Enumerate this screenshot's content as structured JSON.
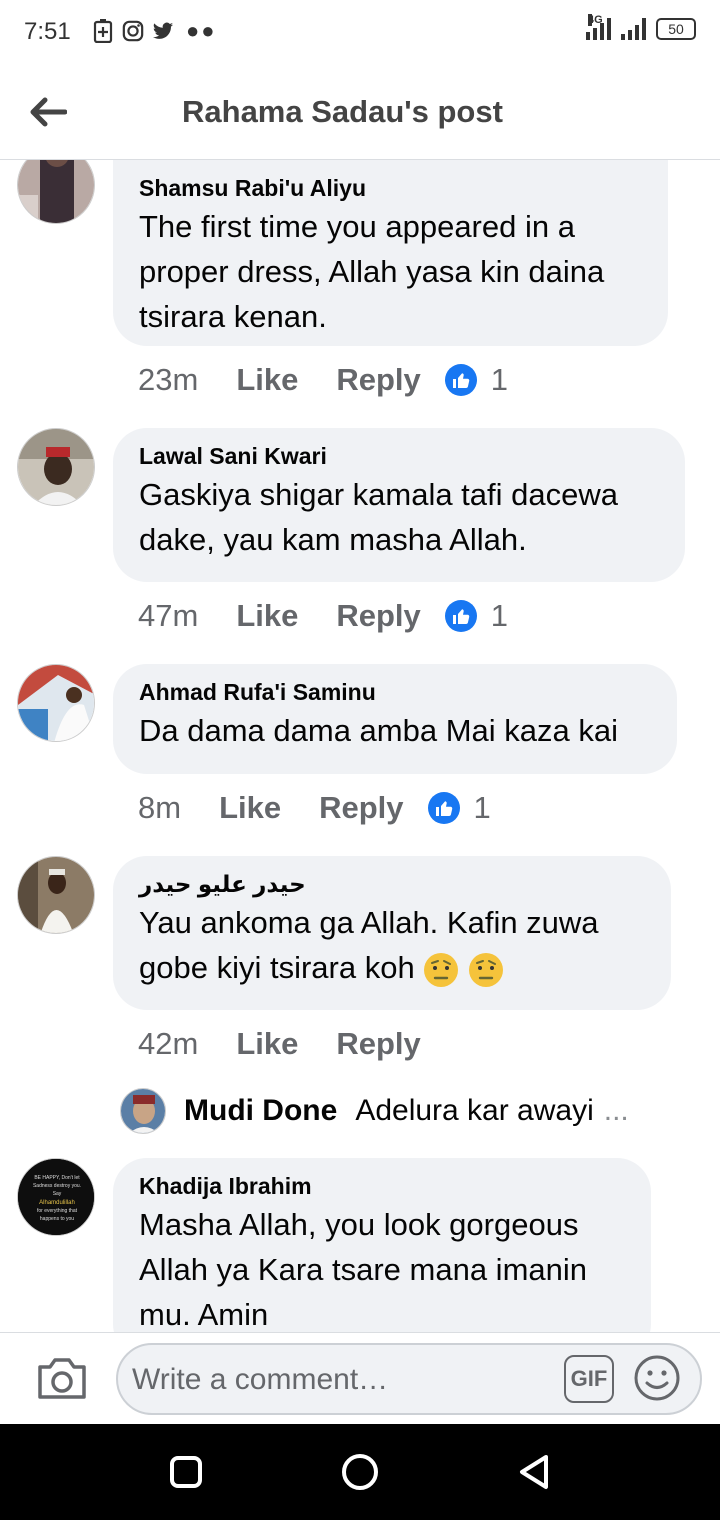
{
  "status_bar": {
    "time": "7:51",
    "network": "4G",
    "battery": "50"
  },
  "header": {
    "title": "Rahama Sadau's post"
  },
  "comments": [
    {
      "author": "Shamsu Rabi'u Aliyu",
      "text": "The first time you appeared in a proper dress, Allah yasa kin daina tsirara kenan.",
      "time": "23m",
      "like_label": "Like",
      "reply_label": "Reply",
      "reactions": "1"
    },
    {
      "author": "Lawal Sani Kwari",
      "text": "Gaskiya shigar kamala tafi dacewa dake, yau kam masha Allah.",
      "time": "47m",
      "like_label": "Like",
      "reply_label": "Reply",
      "reactions": "1"
    },
    {
      "author": "Ahmad Rufa'i Saminu",
      "text": "Da dama dama amba Mai kaza kai",
      "time": "8m",
      "like_label": "Like",
      "reply_label": "Reply",
      "reactions": "1"
    },
    {
      "author": "حيدر عليو حيدر",
      "text": "Yau ankoma ga Allah.  Kafin zuwa gobe kiyi tsirara koh",
      "time": "42m",
      "like_label": "Like",
      "reply_label": "Reply",
      "reply_preview": {
        "name": "Mudi Done",
        "text": "Adelura kar awayi",
        "ellipsis": "..."
      }
    },
    {
      "author": "Khadija Ibrahim",
      "text": "Masha Allah, you look gorgeous Allah ya Kara tsare mana imanin mu. Amin",
      "avatar_text": "BE HAPPY, Don't let Sadness destroy you. Say Alhamdulillah for everything that happens to you"
    }
  ],
  "composer": {
    "placeholder": "Write a comment…",
    "gif_label": "GIF"
  },
  "colors": {
    "bubble": "#f0f2f5",
    "secondary_text": "#65676b",
    "like_blue": "#1877f2"
  }
}
